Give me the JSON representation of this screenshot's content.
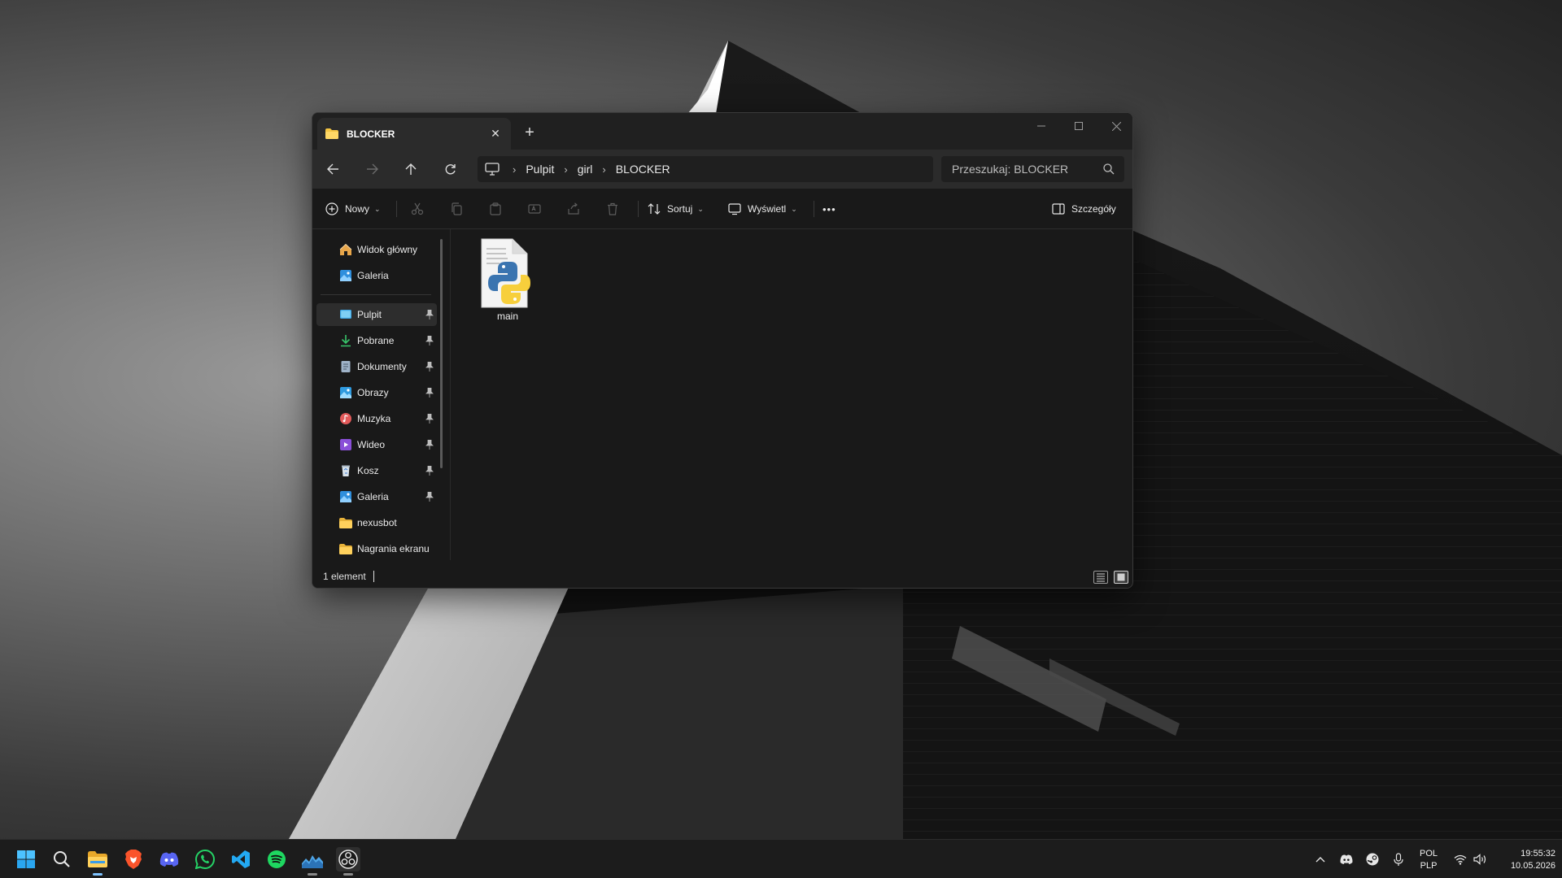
{
  "window": {
    "tab_title": "BLOCKER",
    "new_tab": "+",
    "tab_close": "✕"
  },
  "nav": {
    "breadcrumb": [
      "Pulpit",
      "girl",
      "BLOCKER"
    ],
    "search_placeholder": "Przeszukaj: BLOCKER"
  },
  "toolbar": {
    "new_label": "Nowy",
    "sort_label": "Sortuj",
    "view_label": "Wyświetl",
    "more_label": "•••",
    "details_label": "Szczegóły"
  },
  "sidebar": {
    "items": [
      {
        "label": "Widok główny",
        "icon": "home-icon"
      },
      {
        "label": "Galeria",
        "icon": "gallery-icon"
      },
      {
        "label": "Pulpit",
        "icon": "desktop-icon",
        "pinned": true,
        "active": true
      },
      {
        "label": "Pobrane",
        "icon": "download-icon",
        "pinned": true
      },
      {
        "label": "Dokumenty",
        "icon": "document-icon",
        "pinned": true
      },
      {
        "label": "Obrazy",
        "icon": "pictures-icon",
        "pinned": true
      },
      {
        "label": "Muzyka",
        "icon": "music-icon",
        "pinned": true
      },
      {
        "label": "Wideo",
        "icon": "video-icon",
        "pinned": true
      },
      {
        "label": "Kosz",
        "icon": "recycle-bin-icon",
        "pinned": true
      },
      {
        "label": "Galeria",
        "icon": "gallery-icon",
        "pinned": true
      },
      {
        "label": "nexusbot",
        "icon": "folder-icon"
      },
      {
        "label": "Nagrania ekranu",
        "icon": "folder-icon"
      }
    ]
  },
  "content": {
    "files": [
      {
        "name": "main",
        "icon": "python-file-icon"
      }
    ]
  },
  "status": {
    "count_text": "1 element"
  },
  "taskbar": {
    "apps": [
      "start-icon",
      "search-icon",
      "file-explorer-icon",
      "brave-icon",
      "discord-icon",
      "whatsapp-icon",
      "vscode-icon",
      "spotify-icon",
      "steam-icon",
      "obs-icon"
    ],
    "tray": {
      "lang_line1": "POL",
      "lang_line2": "PLP",
      "time": "19:55:32",
      "date": "10.05.2026"
    }
  },
  "colors": {
    "window_bg": "#191919",
    "navbar_bg": "#2b2b2b",
    "folder_yellow": "#f5c542",
    "taskbar_bg": "#1c1c1c"
  }
}
